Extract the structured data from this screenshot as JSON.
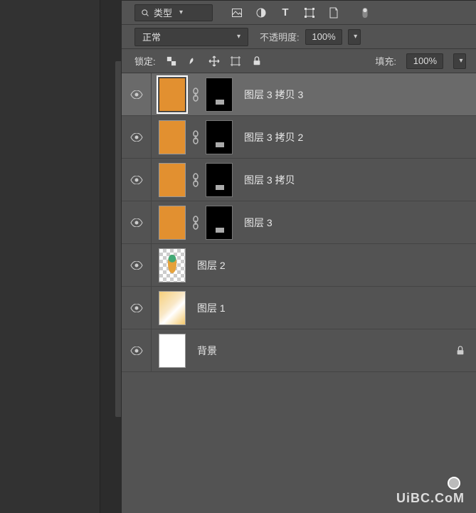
{
  "filter": {
    "search_label": "类型",
    "icons": [
      "image-filter-icon",
      "adjust-filter-icon",
      "type-filter-icon",
      "shape-filter-icon",
      "smart-filter-icon"
    ]
  },
  "blend": {
    "mode": "正常",
    "opacity_label": "不透明度:",
    "opacity_value": "100%"
  },
  "lock": {
    "label": "锁定:",
    "fill_label": "填充:",
    "fill_value": "100%"
  },
  "layers": [
    {
      "name": "图层 3 拷贝 3",
      "thumb": "orange",
      "mask": true,
      "selected": true
    },
    {
      "name": "图层 3 拷贝 2",
      "thumb": "orange",
      "mask": true,
      "selected": false
    },
    {
      "name": "图层 3 拷贝",
      "thumb": "orange",
      "mask": true,
      "selected": false
    },
    {
      "name": "图层 3",
      "thumb": "orange",
      "mask": true,
      "selected": false
    },
    {
      "name": "图层 2",
      "thumb": "checker",
      "mask": false,
      "selected": false
    },
    {
      "name": "图层 1",
      "thumb": "grad",
      "mask": false,
      "selected": false
    },
    {
      "name": "背景",
      "thumb": "white",
      "mask": false,
      "selected": false,
      "locked": true
    }
  ],
  "watermark": {
    "small": "",
    "main": "UiBC.CoM"
  }
}
